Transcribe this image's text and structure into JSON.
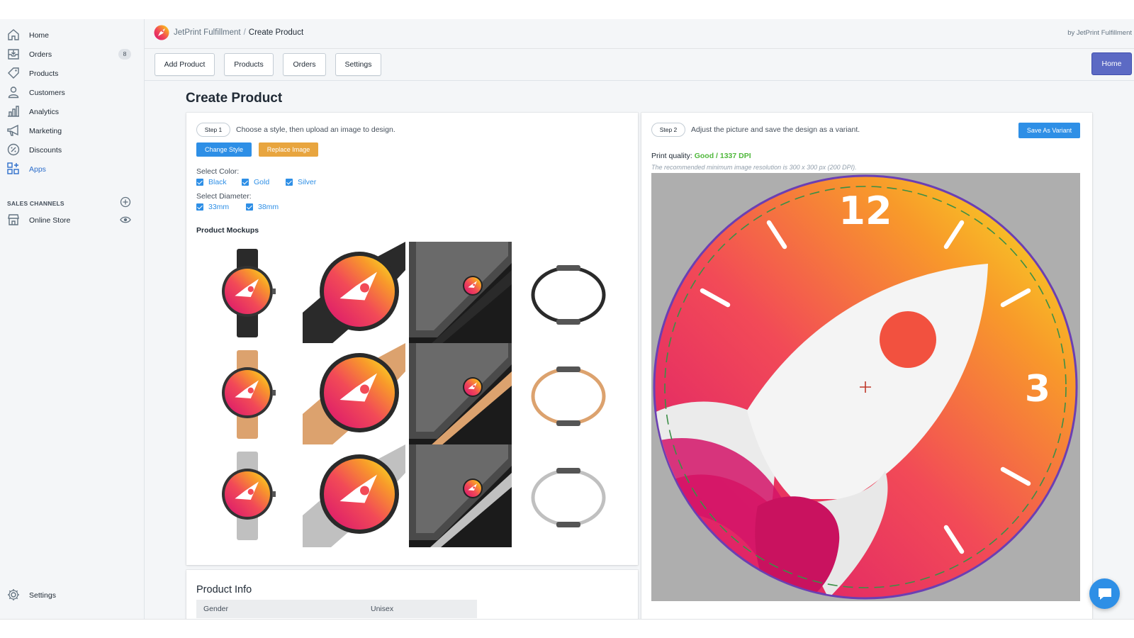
{
  "sidebar": {
    "items": [
      {
        "label": "Home",
        "icon": "home-icon"
      },
      {
        "label": "Orders",
        "icon": "orders-icon",
        "badge": "8"
      },
      {
        "label": "Products",
        "icon": "tag-icon"
      },
      {
        "label": "Customers",
        "icon": "person-icon"
      },
      {
        "label": "Analytics",
        "icon": "bar-chart-icon"
      },
      {
        "label": "Marketing",
        "icon": "megaphone-icon"
      },
      {
        "label": "Discounts",
        "icon": "discount-icon"
      },
      {
        "label": "Apps",
        "icon": "apps-icon"
      }
    ],
    "sales_channels_heading": "SALES CHANNELS",
    "online_store": "Online Store",
    "settings": "Settings"
  },
  "header": {
    "app_name": "JetPrint Fulfillment",
    "separator": "/",
    "current_page": "Create Product",
    "byline": "by JetPrint Fulfillment"
  },
  "toolbar": {
    "buttons": [
      "Add Product",
      "Products",
      "Orders",
      "Settings"
    ],
    "home_button": "Home"
  },
  "page_title": "Create Product",
  "step1": {
    "pill": "Step 1",
    "text": "Choose a style, then upload an image to design.",
    "change_style": "Change Style",
    "replace_image": "Replace Image",
    "select_color_label": "Select Color:",
    "colors": [
      "Black",
      "Gold",
      "Silver"
    ],
    "select_diameter_label": "Select Diameter:",
    "diameters": [
      "33mm",
      "38mm"
    ],
    "mockups_heading": "Product Mockups"
  },
  "step2": {
    "pill": "Step 2",
    "text": "Adjust the picture and save the design as a variant.",
    "save_button": "Save As Variant",
    "print_quality_label": "Print quality:",
    "print_quality_value": "Good / 1337 DPI",
    "note": "The recommended minimum image resolution is 300 x 300 px (200 DPI).",
    "dial_numbers": [
      "12",
      "3"
    ]
  },
  "product_info": {
    "title": "Product Info",
    "rows": [
      {
        "key": "Gender",
        "value": "Unisex"
      }
    ]
  },
  "colors": {
    "accent_blue": "#2e8fe6",
    "accent_orange": "#e8a53f",
    "home_purple": "#5c6ac4",
    "quality_green": "#50b83c",
    "watch_black": "#2a2a2a",
    "watch_gold": "#dca26e",
    "watch_silver": "#c0c0c0"
  }
}
